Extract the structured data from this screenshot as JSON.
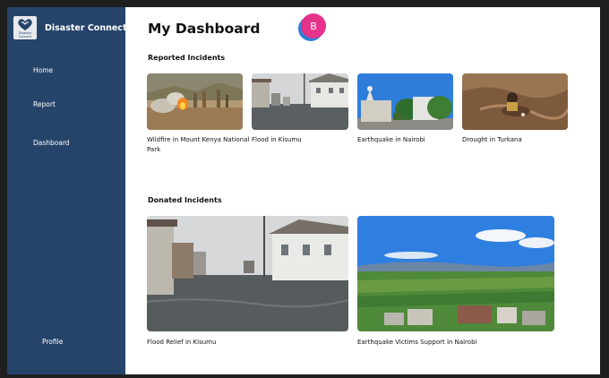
{
  "app": {
    "name": "Disaster Connect",
    "logo_text": "Disaster Connect"
  },
  "sidebar": {
    "items": [
      {
        "label": "Home"
      },
      {
        "label": "Report"
      },
      {
        "label": "Dashboard"
      }
    ],
    "profile_label": "Profile"
  },
  "header": {
    "title": "My Dashboard",
    "badge": "B"
  },
  "sections": {
    "reported": {
      "title": "Reported Incidents",
      "cards": [
        {
          "caption": "Wildfire in Mount Kenya National Park"
        },
        {
          "caption": "Flood in Kisumu"
        },
        {
          "caption": "Earthquake in Nairobi"
        },
        {
          "caption": "Drought in Turkana"
        }
      ]
    },
    "donated": {
      "title": "Donated Incidents",
      "cards": [
        {
          "caption": "Flood Relief in Kisumu"
        },
        {
          "caption": "Earthquake Victims Support in Nairobi"
        }
      ]
    }
  },
  "colors": {
    "sidebar": "#26446a",
    "badge": "#e6328a",
    "badge_shadow": "#2d7fd8"
  }
}
